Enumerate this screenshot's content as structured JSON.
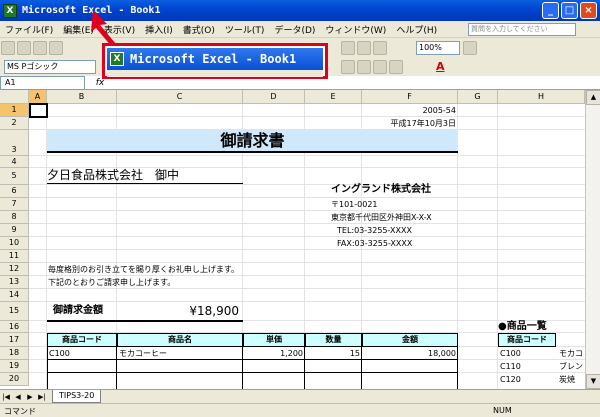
{
  "window": {
    "title": "Microsoft Excel - Book1",
    "app_icon": "X",
    "btn_min": "_",
    "btn_max": "□",
    "btn_close": "×"
  },
  "menu": {
    "items": [
      "ファイル(F)",
      "編集(E)",
      "表示(V)",
      "挿入(I)",
      "書式(O)",
      "ツール(T)",
      "データ(D)",
      "ウィンドウ(W)",
      "ヘルプ(H)"
    ],
    "help_placeholder": "質問を入力してください"
  },
  "toolbar": {
    "zoom": "100%",
    "font_name": "MS Pゴシック",
    "font_color_label": "A"
  },
  "formula": {
    "name_box": "A1",
    "fx_label": "fx"
  },
  "overlay": {
    "title": "Microsoft Excel - Book1",
    "app_icon": "X"
  },
  "sheet": {
    "columns": [
      "A",
      "B",
      "C",
      "D",
      "E",
      "F",
      "G",
      "H"
    ],
    "rows": [
      "1",
      "2",
      "3",
      "4",
      "5",
      "6",
      "7",
      "8",
      "9",
      "10",
      "11",
      "12",
      "13",
      "14",
      "15",
      "16",
      "17",
      "18",
      "19",
      "20"
    ],
    "doc_no": "2005-54",
    "date": "平成17年10月3日",
    "title": "御請求書",
    "customer": "夕日食品株式会社　御中",
    "company": "イングランド株式会社",
    "postal": "〒101-0021",
    "address": "東京都千代田区外神田X-X-X",
    "tel": "TEL:03-3255-XXXX",
    "fax": "FAX:03-3255-XXXX",
    "greeting": "毎度格別のお引き立てを賜り厚くお礼申し上げます。",
    "notice": "下記のとおりご請求申し上げます。",
    "amount_label": "御請求金額",
    "amount_value": "¥18,900",
    "table_headers": [
      "商品コード",
      "商品名",
      "単価",
      "数量",
      "金額"
    ],
    "row18": {
      "code": "C100",
      "name": "モカコーヒー",
      "price": "1,200",
      "qty": "15",
      "amount": "18,000"
    },
    "product_list_title": "●商品一覧",
    "product_list_header": "商品コード",
    "product_codes": [
      "C100",
      "C110",
      "C120"
    ],
    "product_names": [
      "モカコ",
      "ブレン",
      "炭焼"
    ]
  },
  "tabs": {
    "active": "TIPS3-20"
  },
  "status": {
    "mode": "コマンド",
    "num": "NUM"
  }
}
